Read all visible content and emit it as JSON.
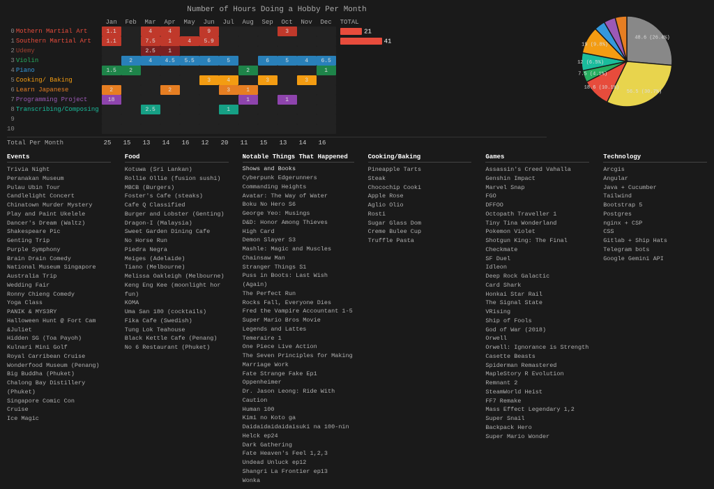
{
  "title": "Number of Hours Doing a Hobby Per Month",
  "months": [
    "Jan",
    "Feb",
    "Mar",
    "Apr",
    "May",
    "Jun",
    "Jul",
    "Aug",
    "Sep",
    "Oct",
    "Nov",
    "Dec"
  ],
  "hobbies": [
    {
      "num": "0",
      "name": "Mothern Martial Art",
      "color": "#e74c3c",
      "values": [
        1.1,
        "",
        4,
        4,
        "",
        9,
        "",
        "",
        "",
        3,
        "",
        ""
      ],
      "total": 21,
      "totalColor": "#e74c3c"
    },
    {
      "num": "1",
      "name": "Southern Martial Art",
      "color": "#e74c3c",
      "values": [
        1.1,
        "",
        7.5,
        1,
        4,
        5.9,
        "",
        "",
        "",
        "",
        "",
        ""
      ],
      "total": 41,
      "totalColor": "#e74c3c"
    },
    {
      "num": "2",
      "name": "Udemy",
      "color": "#a04030",
      "values": [
        "",
        "",
        2.5,
        1,
        "",
        "",
        "",
        "",
        "",
        "",
        "",
        ""
      ],
      "total": "",
      "totalColor": "#a04030"
    },
    {
      "num": "3",
      "name": "Violin",
      "color": "#27ae60",
      "values": [
        "",
        2,
        4,
        4.5,
        5.5,
        6,
        5,
        "",
        6,
        5,
        4,
        6.5
      ],
      "total": "",
      "totalColor": "#27ae60"
    },
    {
      "num": "4",
      "name": "Piano",
      "color": "#3498db",
      "values": [
        1.5,
        2,
        "",
        "",
        "",
        "",
        "",
        2,
        "",
        "",
        "",
        1
      ],
      "total": "",
      "totalColor": "#3498db"
    },
    {
      "num": "5",
      "name": "Cooking/ Baking",
      "color": "#f39c12",
      "values": [
        "",
        "",
        "",
        "",
        "",
        3,
        4,
        "",
        3,
        "",
        3,
        ""
      ],
      "total": "",
      "totalColor": "#f39c12"
    },
    {
      "num": "6",
      "name": "Learn Japanese",
      "color": "#e67e22",
      "values": [
        2,
        "",
        "",
        2,
        "",
        "",
        3,
        1,
        "",
        "",
        "",
        ""
      ],
      "total": "",
      "totalColor": "#e67e22"
    },
    {
      "num": "7",
      "name": "Programming Project",
      "color": "#9b59b6",
      "values": [
        18,
        "",
        "",
        "",
        "",
        "",
        "",
        1,
        "",
        1,
        "",
        ""
      ],
      "total": "",
      "totalColor": "#9b59b6"
    },
    {
      "num": "8",
      "name": "Transcribing/Composing",
      "color": "#1abc9c",
      "values": [
        "",
        "",
        2.5,
        "",
        "",
        "",
        1,
        "",
        "",
        "",
        "",
        ""
      ],
      "total": "",
      "totalColor": "#1abc9c"
    },
    {
      "num": "9",
      "name": "",
      "color": "#555",
      "values": [
        "",
        "",
        "",
        "",
        "",
        "",
        "",
        "",
        "",
        "",
        "",
        ""
      ],
      "total": "",
      "totalColor": "#555"
    },
    {
      "num": "10",
      "name": "",
      "color": "#555",
      "values": [
        "",
        "",
        "",
        "",
        "",
        "",
        "",
        "",
        "",
        "",
        "",
        ""
      ],
      "total": "",
      "totalColor": "#555"
    }
  ],
  "monthlyTotals": [
    "25",
    "15",
    "13",
    "14",
    "16",
    "12",
    "20",
    "11",
    "15",
    "13",
    "14",
    "16"
  ],
  "totalLabel": "Total Per Month",
  "totalHeaderLabel": "TOTAL",
  "pieData": [
    {
      "label": "48.6 (26.4%)",
      "color": "#888888",
      "startAngle": 0,
      "endAngle": 95
    },
    {
      "label": "56.5 (30.7%)",
      "color": "#e8d44d",
      "startAngle": 95,
      "endAngle": 206
    },
    {
      "label": "18.6 (10.1%)",
      "color": "#e74c3c",
      "startAngle": 206,
      "endAngle": 243
    },
    {
      "label": "7.5 (4.1%)",
      "color": "#27ae60",
      "startAngle": 243,
      "endAngle": 258
    },
    {
      "label": "12 (6.5%)",
      "color": "#1abc9c",
      "startAngle": 258,
      "endAngle": 281
    },
    {
      "label": "19 (9.8%)",
      "color": "#f39c12",
      "startAngle": 281,
      "endAngle": 316
    },
    {
      "label": "",
      "color": "#3498db",
      "startAngle": 316,
      "endAngle": 330
    },
    {
      "label": "",
      "color": "#9b59b6",
      "startAngle": 330,
      "endAngle": 345
    },
    {
      "label": "",
      "color": "#e67e22",
      "startAngle": 345,
      "endAngle": 360
    }
  ],
  "eventsCol": {
    "header": "Events",
    "items": [
      "Trivia Night",
      "Peranakan Museum",
      "Pulau Ubin Tour",
      "Candlelight Concert",
      "Chinatown Murder Mystery",
      "Play and Paint Ukelele",
      "Dancer's Dream (Waltz)",
      "Shakespeare Pic",
      "Genting Trip",
      "Purple Symphony",
      "Brain Drain Comedy",
      "National Museum Singapore",
      "Australia Trip",
      "Wedding Fair",
      "Ronny Chieng Comedy",
      "Yoga Class",
      "PANIK & MYS3RY",
      "Halloween Hunt @ Fort Cam",
      "&Juliet",
      "Hidden SG (Toa Payoh)",
      "Kulnari Mini Golf",
      "Royal Carribean Cruise",
      "Wonderfood Museum (Penang)",
      "Big Buddha (Phuket)",
      "Chalong Bay Distillery (Phuket)",
      "Singapore Comic Con",
      "Cruise",
      "Ice Magic"
    ]
  },
  "foodCol": {
    "header": "Food",
    "items": [
      "Kotuwa (Sri Lankan)",
      "Rollie Ollie (fusion sushi)",
      "MBCB (Burgers)",
      "Foster's Cafe (steaks)",
      "Cafe Q Classified",
      "Burger and Lobster (Genting)",
      "Dragon-I (Malaysia)",
      "Sweet Garden Dining Cafe",
      "No Horse Run",
      "Piedra Negra",
      "Meiges (Adelaide)",
      "Tiano (Melbourne)",
      "Melissa Oakleigh (Melbourne)",
      "Keng Eng Kee (moonlight hor fun)",
      "KOMA",
      "Uma San 180 (cocktails)",
      "Fika Cafe (Swedish)",
      "Tung Lok Teahouse",
      "Black Kettle Cafe (Penang)",
      "No 6 Restaurant (Phuket)"
    ]
  },
  "notableCol": {
    "header": "Notable Things That Happened",
    "subheader": "Shows and Books",
    "items": [
      "Cyberpunk Edgerunners",
      "Commanding Heights",
      "Avatar: The Way of Water",
      "Boku No Hero S6",
      "George Yeo: Musings",
      "D&D: Honor Among Thieves",
      "High Card",
      "Demon Slayer S3",
      "Mashle: Magic and Muscles",
      "Chainsaw Man",
      "Stranger Things S1",
      "Puss in Boots: Last Wish (Again)",
      "The Perfect Run",
      "Rocks Fall, Everyone Dies",
      "Fred the Vampire Accountant 1-5",
      "Super Mario Bros Movie",
      "Legends and Lattes",
      "Temeraire 1",
      "One Piece Live Action",
      "The Seven Principles for Making Marriage Work",
      "Fate Strange Fake Ep1",
      "Oppenheimer",
      "Dr. Jason Leong: Ride With Caution",
      "Human 100",
      "Kimi no Koto ga Daidaidaidaidaisuki na 100-nin",
      "Helck ep24",
      "Dark Gathering",
      "Fate Heaven's Feel 1,2,3",
      "Undead Unluck ep12",
      "Shangri La Frontier ep13",
      "Wonka"
    ]
  },
  "cookingCol": {
    "header": "Cooking/Baking",
    "items": [
      "Pineapple Tarts",
      "Steak",
      "Chocochip Cooki",
      "Apple Rose",
      "Aglio Olio",
      "Rosti",
      "Sugar Glass Dom",
      "Creme Bulee Cup",
      "Truffle Pasta"
    ]
  },
  "gamesCol": {
    "header": "Games",
    "items": [
      "Assassin's Creed Vahalla",
      "Genshin Impact",
      "Marvel Snap",
      "FGO",
      "DFFOO",
      "Octopath Traveller 1",
      "Tiny Tina Wonderland",
      "Pokemon Violet",
      "Shotgun King: The Final Checkmate",
      "SF Duel",
      "Idleon",
      "Deep Rock Galactic",
      "Card Shark",
      "Honkai Star Rail",
      "The Signal State",
      "VRising",
      "Ship of Fools",
      "God of War (2018)",
      "Orwell",
      "Orwell: Ignorance is Strength",
      "Casette Beasts",
      "Spiderman Remastered",
      "MapleStory R Evolution",
      "Remnant 2",
      "SteamWorld Heist",
      "FF7 Remake",
      "Mass Effect Legendary 1,2",
      "Super Snail",
      "Backpack Hero",
      "Super Mario Wonder"
    ]
  },
  "techCol": {
    "header": "Technology",
    "items": [
      "Arcgis",
      "Angular",
      "Java + Cucumber",
      "Tailwind",
      "Bootstrap 5",
      "Postgres",
      "nginx + CSP",
      "CSS",
      "Gitlab + Ship Hats",
      "Telegram bots",
      "Google Gemini API"
    ]
  }
}
